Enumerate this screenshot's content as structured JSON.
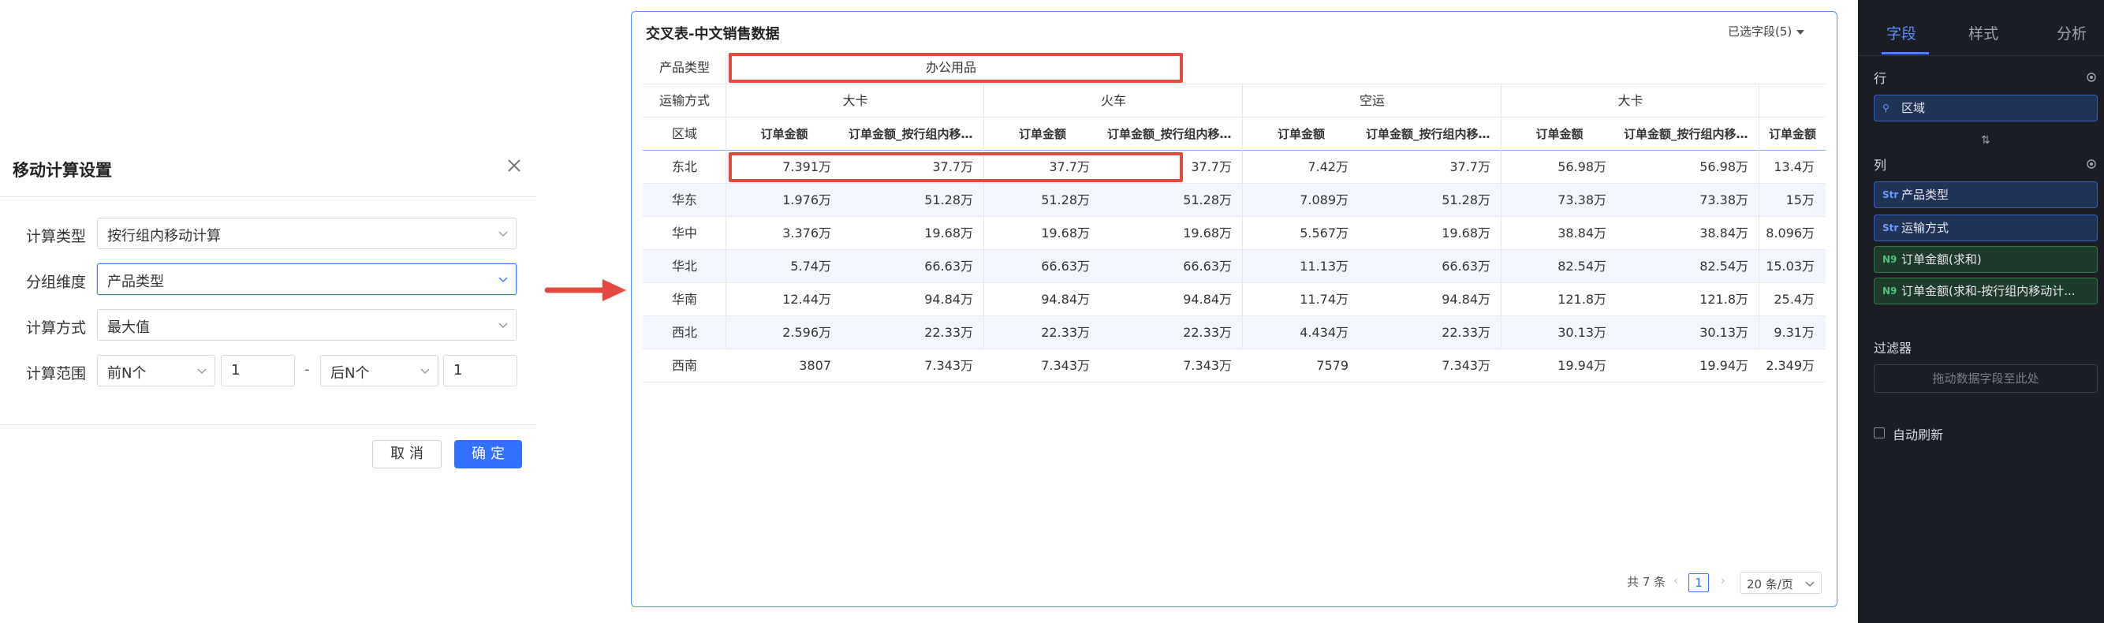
{
  "dialog": {
    "title": "移动计算设置",
    "calc_type_label": "计算类型",
    "calc_type_value": "按行组内移动计算",
    "group_dim_label": "分组维度",
    "group_dim_value": "产品类型",
    "calc_method_label": "计算方式",
    "calc_method_value": "最大值",
    "range_label": "计算范围",
    "range_before_select": "前N个",
    "range_before_value": "1",
    "range_dash": "-",
    "range_after_select": "后N个",
    "range_after_value": "1",
    "cancel_label": "取消",
    "ok_label": "确定"
  },
  "table": {
    "title": "交叉表-中文销售数据",
    "selected_fields": "已选字段(5)",
    "row_header_product": "产品类型",
    "row_header_transport": "运输方式",
    "row_header_region": "区域",
    "product_group": "办公用品",
    "transport_groups": [
      "大卡",
      "火车",
      "空运",
      "大卡"
    ],
    "measure_headers": [
      "订单金额",
      "订单金额_按行组内移动计算",
      "订单金额",
      "订单金额_按行组内移动计算",
      "订单金额",
      "订单金额_按行组内移动计算",
      "订单金额",
      "订单金额_按行组内移动计算",
      "订单金额"
    ],
    "rows": [
      {
        "region": "东北",
        "values": [
          "7.391万",
          "37.7万",
          "37.7万",
          "37.7万",
          "7.42万",
          "37.7万",
          "56.98万",
          "56.98万",
          "13.4万"
        ]
      },
      {
        "region": "华东",
        "values": [
          "1.976万",
          "51.28万",
          "51.28万",
          "51.28万",
          "7.089万",
          "51.28万",
          "73.38万",
          "73.38万",
          "15万"
        ]
      },
      {
        "region": "华中",
        "values": [
          "3.376万",
          "19.68万",
          "19.68万",
          "19.68万",
          "5.567万",
          "19.68万",
          "38.84万",
          "38.84万",
          "8.096万"
        ]
      },
      {
        "region": "华北",
        "values": [
          "5.74万",
          "66.63万",
          "66.63万",
          "66.63万",
          "11.13万",
          "66.63万",
          "82.54万",
          "82.54万",
          "15.03万"
        ]
      },
      {
        "region": "华南",
        "values": [
          "12.44万",
          "94.84万",
          "94.84万",
          "94.84万",
          "11.74万",
          "94.84万",
          "121.8万",
          "121.8万",
          "25.4万"
        ]
      },
      {
        "region": "西北",
        "values": [
          "2.596万",
          "22.33万",
          "22.33万",
          "22.33万",
          "4.434万",
          "22.33万",
          "30.13万",
          "30.13万",
          "9.31万"
        ]
      },
      {
        "region": "西南",
        "values": [
          "3807",
          "7.343万",
          "7.343万",
          "7.343万",
          "7579",
          "7.343万",
          "19.94万",
          "19.94万",
          "2.349万"
        ]
      }
    ],
    "pager_total": "共 7 条",
    "pager_current": "1",
    "pager_size": "20 条/页"
  },
  "panel": {
    "tabs": [
      "字段",
      "样式",
      "分析"
    ],
    "rows_label": "行",
    "row_chip": "区域",
    "cols_label": "列",
    "col_chips": [
      "产品类型",
      "运输方式"
    ],
    "measure_chips": [
      "订单金额(求和)",
      "订单金额(求和-按行组内移动计..."
    ],
    "dim_icon": "Str",
    "meas_icon": "N9",
    "filter_label": "过滤器",
    "filter_placeholder": "拖动数据字段至此处",
    "auto_refresh_label": "自动刷新"
  },
  "colors": {
    "accent": "#3370ff",
    "highlight": "#e34b3f",
    "panel_bg": "#1a1d24"
  }
}
